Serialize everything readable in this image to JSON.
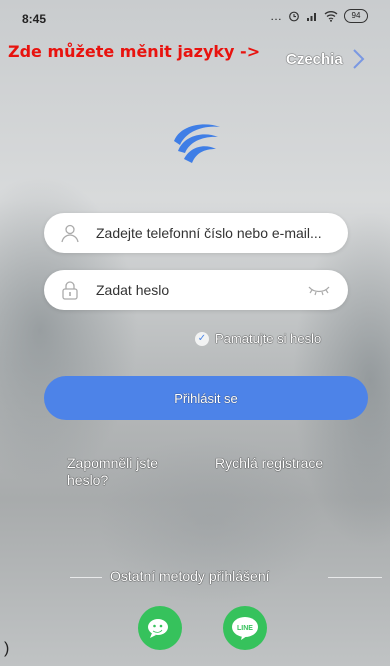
{
  "status_bar": {
    "time": "8:45",
    "icons": [
      "more-dots-icon",
      "alarm-icon",
      "signal-icon",
      "wifi-icon",
      "battery-icon"
    ],
    "battery": "94"
  },
  "language": {
    "hint": "Zde můžete měnit jazyky ->",
    "selected": "Czechia"
  },
  "login": {
    "account_placeholder": "Zadejte telefonní číslo nebo e-mail...",
    "password_placeholder": "Zadat heslo",
    "remember_label": "Pamatujte si heslo",
    "remember_checked": true,
    "submit_label": "Přihlásit se"
  },
  "links": {
    "forgot": "Zapomněli jste heslo?",
    "register": "Rychlá registrace"
  },
  "other_methods": {
    "label": "Ostatní metody přihlášení",
    "providers": [
      "wechat-icon",
      "line-icon"
    ],
    "line_text": "LINE"
  },
  "colors": {
    "accent": "#4d83e8",
    "hint_red": "#e8130f",
    "social_green": "#36c25c"
  },
  "misc": {
    "edge_char": ")"
  }
}
